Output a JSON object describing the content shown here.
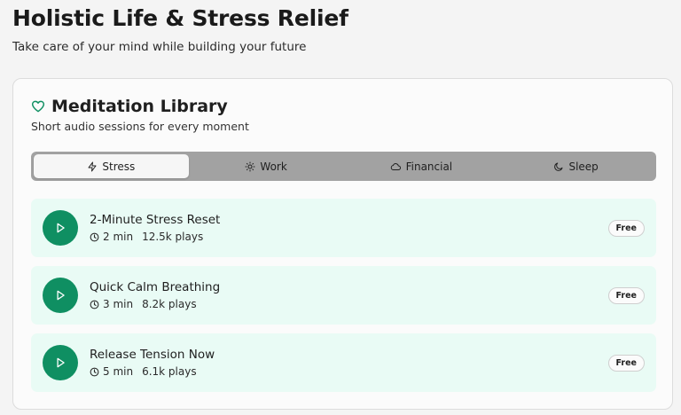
{
  "header": {
    "title": "Holistic Life & Stress Relief",
    "subtitle": "Take care of your mind while building your future"
  },
  "library": {
    "icon": "heart-icon",
    "title": "Meditation Library",
    "subtitle": "Short audio sessions for every moment",
    "accent_color": "#0f8f62"
  },
  "tabs": [
    {
      "label": "Stress",
      "icon": "lightning-icon",
      "active": true
    },
    {
      "label": "Work",
      "icon": "sun-icon",
      "active": false
    },
    {
      "label": "Financial",
      "icon": "cloud-icon",
      "active": false
    },
    {
      "label": "Sleep",
      "icon": "moon-icon",
      "active": false
    }
  ],
  "sessions": [
    {
      "title": "2-Minute Stress Reset",
      "duration": "2 min",
      "plays": "12.5k plays",
      "badge": "Free"
    },
    {
      "title": "Quick Calm Breathing",
      "duration": "3 min",
      "plays": "8.2k plays",
      "badge": "Free"
    },
    {
      "title": "Release Tension Now",
      "duration": "5 min",
      "plays": "6.1k plays",
      "badge": "Free"
    }
  ]
}
